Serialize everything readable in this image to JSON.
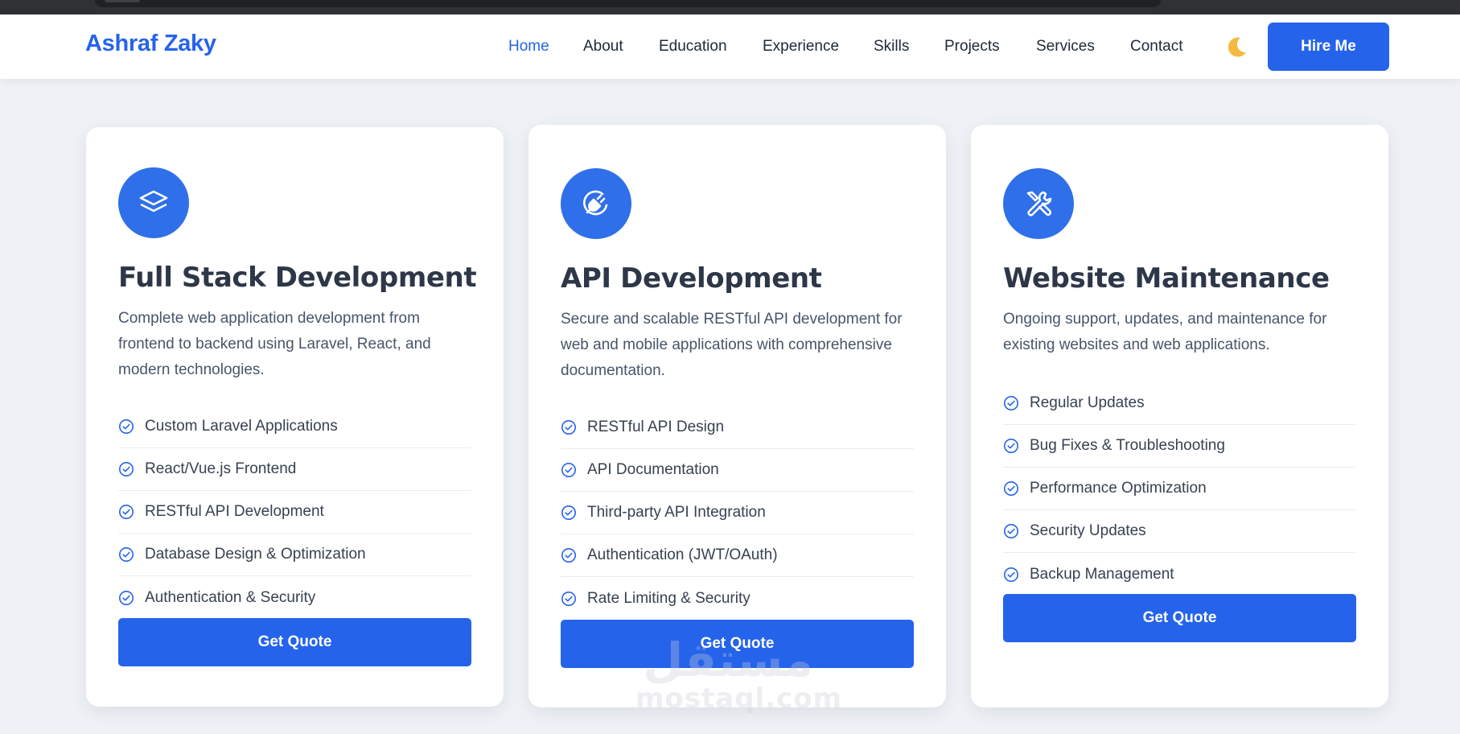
{
  "nav": {
    "brand": "Ashraf Zaky",
    "links": [
      {
        "label": "Home",
        "active": true
      },
      {
        "label": "About"
      },
      {
        "label": "Education"
      },
      {
        "label": "Experience"
      },
      {
        "label": "Skills"
      },
      {
        "label": "Projects"
      },
      {
        "label": "Services"
      },
      {
        "label": "Contact"
      }
    ],
    "theme_toggle_icon": "moon-icon",
    "hire_label": "Hire Me"
  },
  "colors": {
    "accent": "#2563eb",
    "heading": "#2d3748",
    "page_bg": "#eef1f6"
  },
  "cards": [
    {
      "icon": "layers-icon",
      "title": "Full Stack Development",
      "description": "Complete web application development from frontend to backend using Laravel, React, and modern technologies.",
      "features": [
        "Custom Laravel Applications",
        "React/Vue.js Frontend",
        "RESTful API Development",
        "Database Design & Optimization",
        "Authentication & Security"
      ],
      "button_label": "Get Quote"
    },
    {
      "icon": "plug-icon",
      "title": "API Development",
      "description": "Secure and scalable RESTful API development for web and mobile applications with comprehensive documentation.",
      "features": [
        "RESTful API Design",
        "API Documentation",
        "Third-party API Integration",
        "Authentication (JWT/OAuth)",
        "Rate Limiting & Security"
      ],
      "button_label": "Get Quote"
    },
    {
      "icon": "tools-icon",
      "title": "Website Maintenance",
      "description": "Ongoing support, updates, and maintenance for existing websites and web applications.",
      "features": [
        "Regular Updates",
        "Bug Fixes & Troubleshooting",
        "Performance Optimization",
        "Security Updates",
        "Backup Management"
      ],
      "button_label": "Get Quote"
    }
  ],
  "watermark": {
    "arabic": "مستقل",
    "latin": "mostaql.com"
  }
}
